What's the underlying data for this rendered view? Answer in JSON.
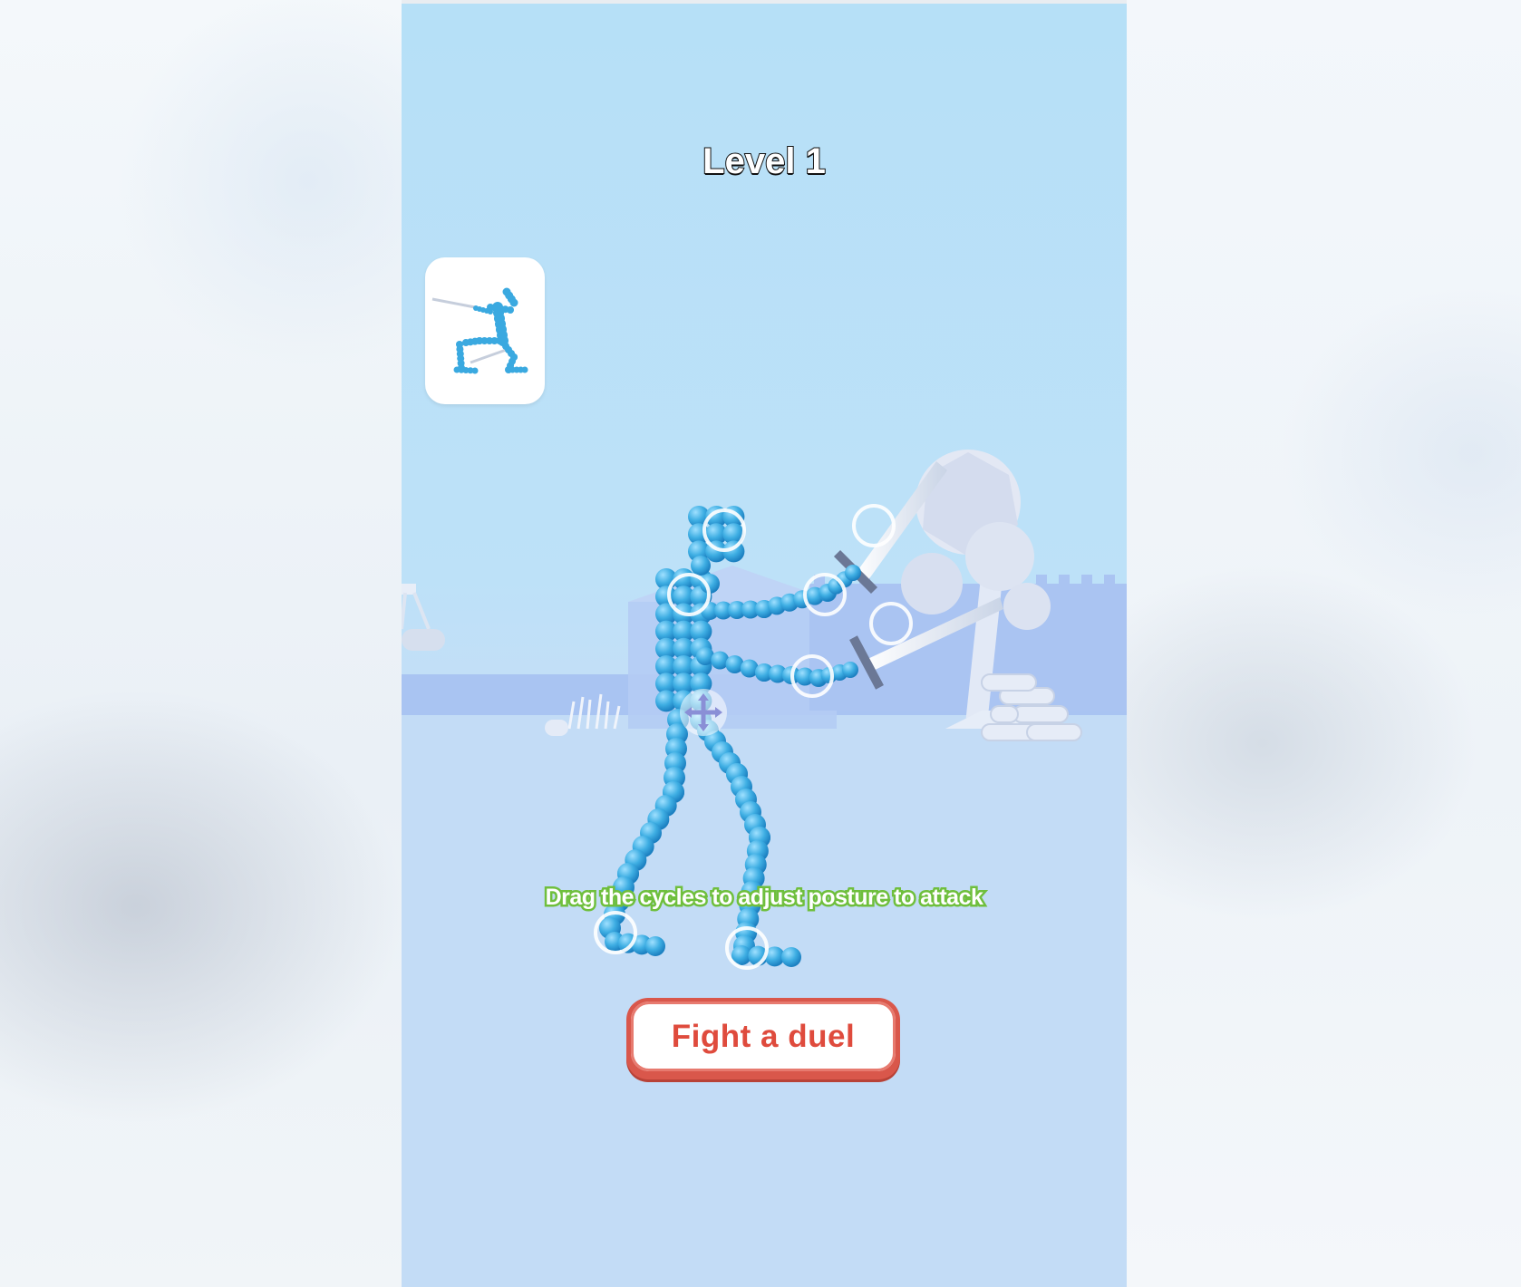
{
  "game": {
    "level_label": "Level 1",
    "hint_text": "Drag the cycles to adjust posture to attack",
    "action_button_label": "Fight a duel"
  },
  "colors": {
    "sky": "#b6e0f7",
    "ground": "#c4dcf5",
    "figure": "#3aa9e0",
    "hint_outline": "#6fbf3d",
    "button_red": "#d9574b"
  },
  "icons": {
    "thumbnail": "target-pose-icon",
    "move": "move-arrows-icon",
    "handles": "drag-circle-icon"
  }
}
